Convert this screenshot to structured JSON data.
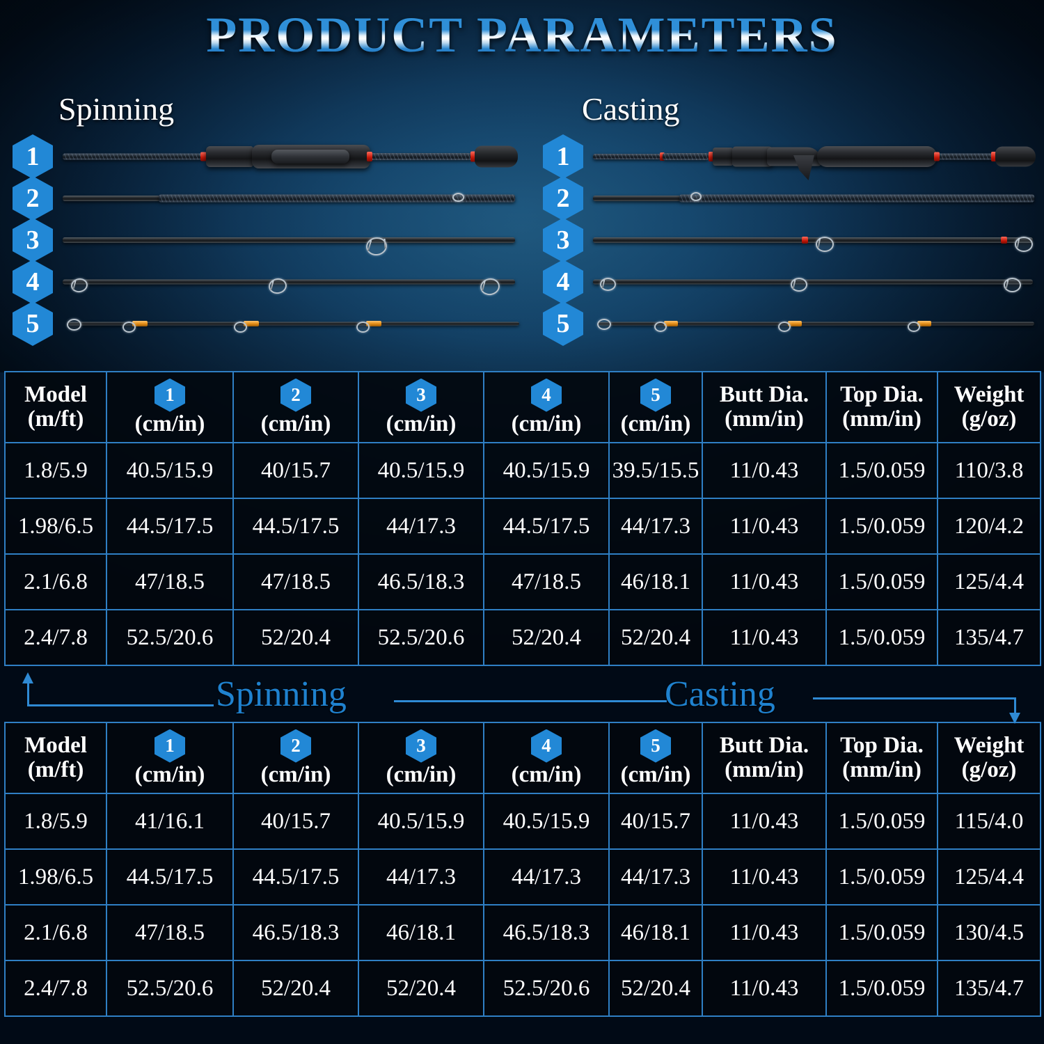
{
  "title": "PRODUCT PARAMETERS",
  "diagram": {
    "spinning_label": "Spinning",
    "casting_label": "Casting",
    "section_badges": [
      "1",
      "2",
      "3",
      "4",
      "5"
    ]
  },
  "connector": {
    "spinning_label": "Spinning",
    "casting_label": "Casting"
  },
  "colors": {
    "accent_blue": "#2288d6",
    "border_blue": "#2f7fc4",
    "title_blue": "#2f8fd8",
    "label_white": "#ffffff",
    "background_dark": "#02070e",
    "red_accent": "#c01608",
    "tip_orange": "#e08a14"
  },
  "table_spinning": {
    "caption": "Spinning",
    "headers": [
      {
        "top": "Model",
        "badge": null,
        "bottom": "(m/ft)"
      },
      {
        "top": null,
        "badge": "1",
        "bottom": "(cm/in)"
      },
      {
        "top": null,
        "badge": "2",
        "bottom": "(cm/in)"
      },
      {
        "top": null,
        "badge": "3",
        "bottom": "(cm/in)"
      },
      {
        "top": null,
        "badge": "4",
        "bottom": "(cm/in)"
      },
      {
        "top": null,
        "badge": "5",
        "bottom": "(cm/in)"
      },
      {
        "top": "Butt Dia.",
        "badge": null,
        "bottom": "(mm/in)"
      },
      {
        "top": "Top Dia.",
        "badge": null,
        "bottom": "(mm/in)"
      },
      {
        "top": "Weight",
        "badge": null,
        "bottom": "(g/oz)"
      }
    ],
    "rows": [
      [
        "1.8/5.9",
        "40.5/15.9",
        "40/15.7",
        "40.5/15.9",
        "40.5/15.9",
        "39.5/15.5",
        "11/0.43",
        "1.5/0.059",
        "110/3.8"
      ],
      [
        "1.98/6.5",
        "44.5/17.5",
        "44.5/17.5",
        "44/17.3",
        "44.5/17.5",
        "44/17.3",
        "11/0.43",
        "1.5/0.059",
        "120/4.2"
      ],
      [
        "2.1/6.8",
        "47/18.5",
        "47/18.5",
        "46.5/18.3",
        "47/18.5",
        "46/18.1",
        "11/0.43",
        "1.5/0.059",
        "125/4.4"
      ],
      [
        "2.4/7.8",
        "52.5/20.6",
        "52/20.4",
        "52.5/20.6",
        "52/20.4",
        "52/20.4",
        "11/0.43",
        "1.5/0.059",
        "135/4.7"
      ]
    ]
  },
  "table_casting": {
    "caption": "Casting",
    "headers": [
      {
        "top": "Model",
        "badge": null,
        "bottom": "(m/ft)"
      },
      {
        "top": null,
        "badge": "1",
        "bottom": "(cm/in)"
      },
      {
        "top": null,
        "badge": "2",
        "bottom": "(cm/in)"
      },
      {
        "top": null,
        "badge": "3",
        "bottom": "(cm/in)"
      },
      {
        "top": null,
        "badge": "4",
        "bottom": "(cm/in)"
      },
      {
        "top": null,
        "badge": "5",
        "bottom": "(cm/in)"
      },
      {
        "top": "Butt Dia.",
        "badge": null,
        "bottom": "(mm/in)"
      },
      {
        "top": "Top Dia.",
        "badge": null,
        "bottom": "(mm/in)"
      },
      {
        "top": "Weight",
        "badge": null,
        "bottom": "(g/oz)"
      }
    ],
    "rows": [
      [
        "1.8/5.9",
        "41/16.1",
        "40/15.7",
        "40.5/15.9",
        "40.5/15.9",
        "40/15.7",
        "11/0.43",
        "1.5/0.059",
        "115/4.0"
      ],
      [
        "1.98/6.5",
        "44.5/17.5",
        "44.5/17.5",
        "44/17.3",
        "44/17.3",
        "44/17.3",
        "11/0.43",
        "1.5/0.059",
        "125/4.4"
      ],
      [
        "2.1/6.8",
        "47/18.5",
        "46.5/18.3",
        "46/18.1",
        "46.5/18.3",
        "46/18.1",
        "11/0.43",
        "1.5/0.059",
        "130/4.5"
      ],
      [
        "2.4/7.8",
        "52.5/20.6",
        "52/20.4",
        "52/20.4",
        "52.5/20.6",
        "52/20.4",
        "11/0.43",
        "1.5/0.059",
        "135/4.7"
      ]
    ]
  }
}
